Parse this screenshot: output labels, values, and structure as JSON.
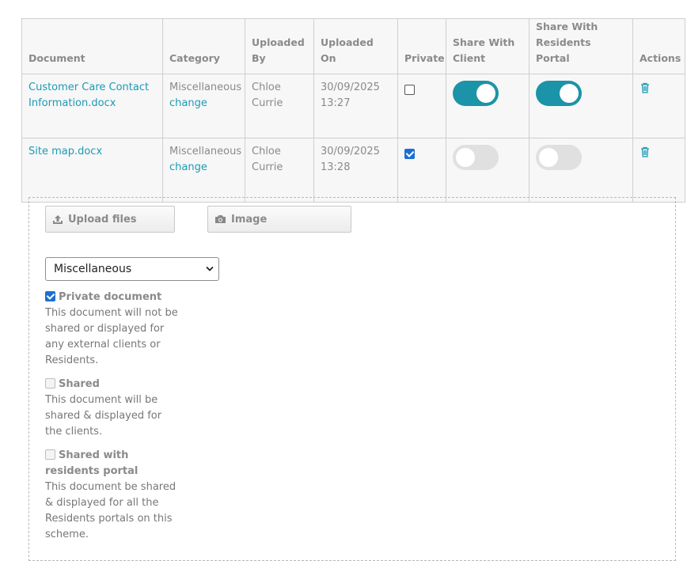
{
  "table": {
    "headers": [
      "Document",
      "Category",
      "Uploaded By",
      "Uploaded On",
      "Private",
      "Share With Client",
      "Share With Residents Portal",
      "Actions"
    ],
    "rows": [
      {
        "document": "Customer Care Contact Information.docx",
        "category": "Miscellaneous",
        "change": "change",
        "uploaded_by": "Chloe Currie",
        "uploaded_on": "30/09/2025 13:27",
        "private": false,
        "share_client": true,
        "share_residents": true
      },
      {
        "document": "Site map.docx",
        "category": "Miscellaneous",
        "change": "change",
        "uploaded_by": "Chloe Currie",
        "uploaded_on": "30/09/2025 13:28",
        "private": true,
        "share_client": false,
        "share_residents": false
      }
    ]
  },
  "upload": {
    "upload_files_label": "Upload files",
    "image_label": "Image",
    "category_selected": "Miscellaneous",
    "options": [
      {
        "title": "Private document",
        "checked": true,
        "description": "This document will not be shared or displayed for any external clients or Residents."
      },
      {
        "title": "Shared",
        "checked": false,
        "description": "This document will be shared & displayed for the clients."
      },
      {
        "title": "Shared with residents portal",
        "checked": false,
        "description": "This document be shared & displayed for all the Residents portals on this scheme."
      }
    ]
  },
  "icons": {
    "upload": "upload-icon",
    "camera": "camera-icon",
    "trash": "trash-icon",
    "chevron": "chevron-down-icon"
  },
  "colors": {
    "link": "#1b9bb3",
    "toggle_on": "#1b93a8",
    "toggle_off": "#e0e0e0",
    "checkbox_on": "#1c6fd1"
  }
}
